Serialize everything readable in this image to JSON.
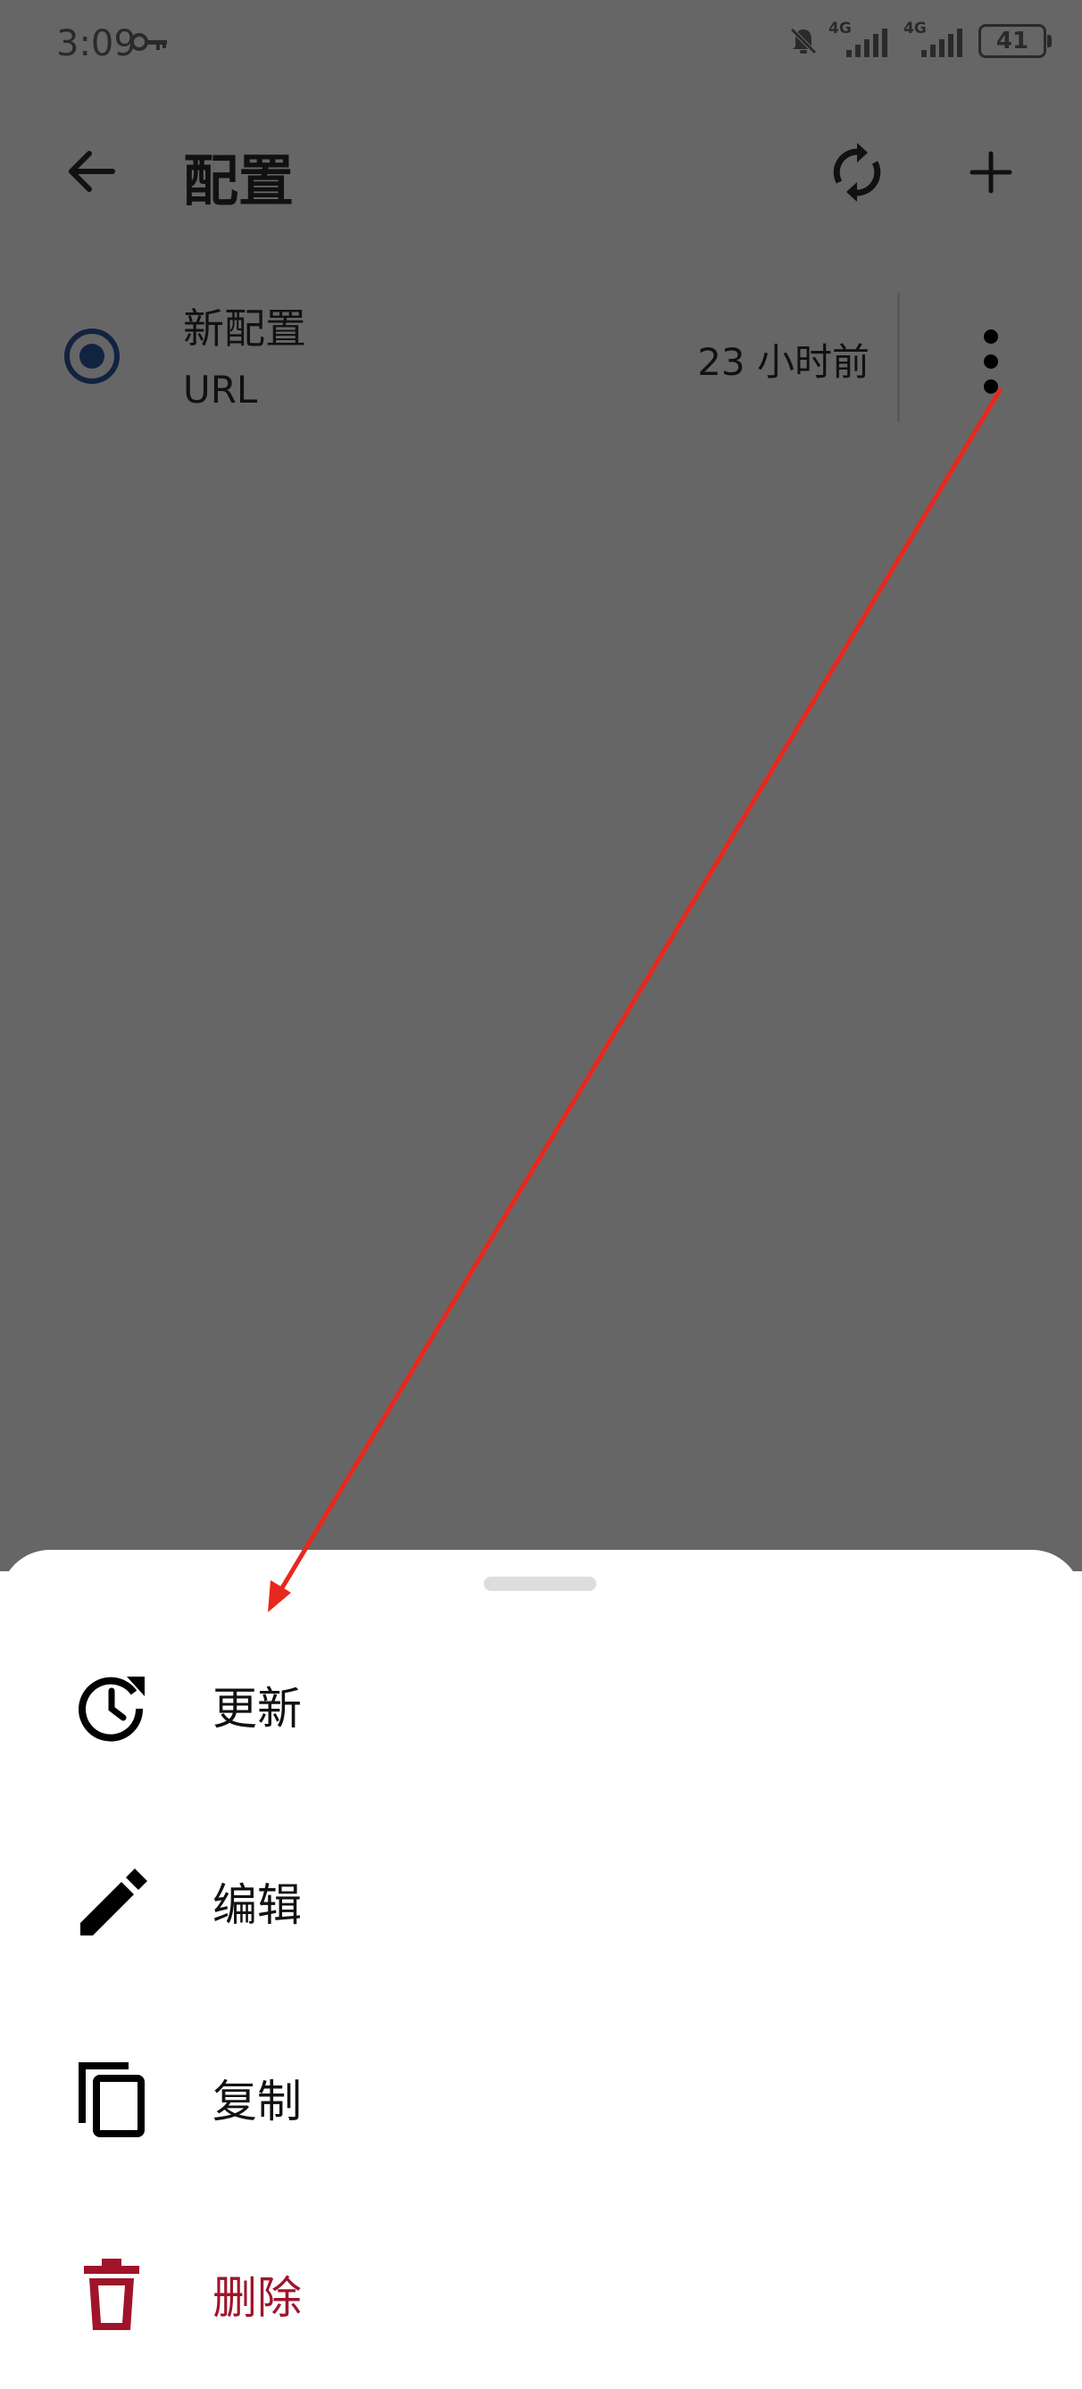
{
  "status_bar": {
    "time": "3:09",
    "battery": "41",
    "network_1": "4G",
    "network_2": "4G"
  },
  "header": {
    "title": "配置"
  },
  "profiles": [
    {
      "name": "新配置",
      "type": "URL",
      "updated": "23 小时前",
      "selected": true
    }
  ],
  "sheet": {
    "items": [
      {
        "label": "更新",
        "icon": "update-clock-icon"
      },
      {
        "label": "编辑",
        "icon": "pencil-icon"
      },
      {
        "label": "复制",
        "icon": "copy-icon"
      },
      {
        "label": "删除",
        "icon": "trash-icon"
      }
    ]
  },
  "colors": {
    "scrim": "#666666",
    "radio_selected": "#122341",
    "danger": "#a0142a",
    "annotation_arrow": "#e8281e"
  }
}
